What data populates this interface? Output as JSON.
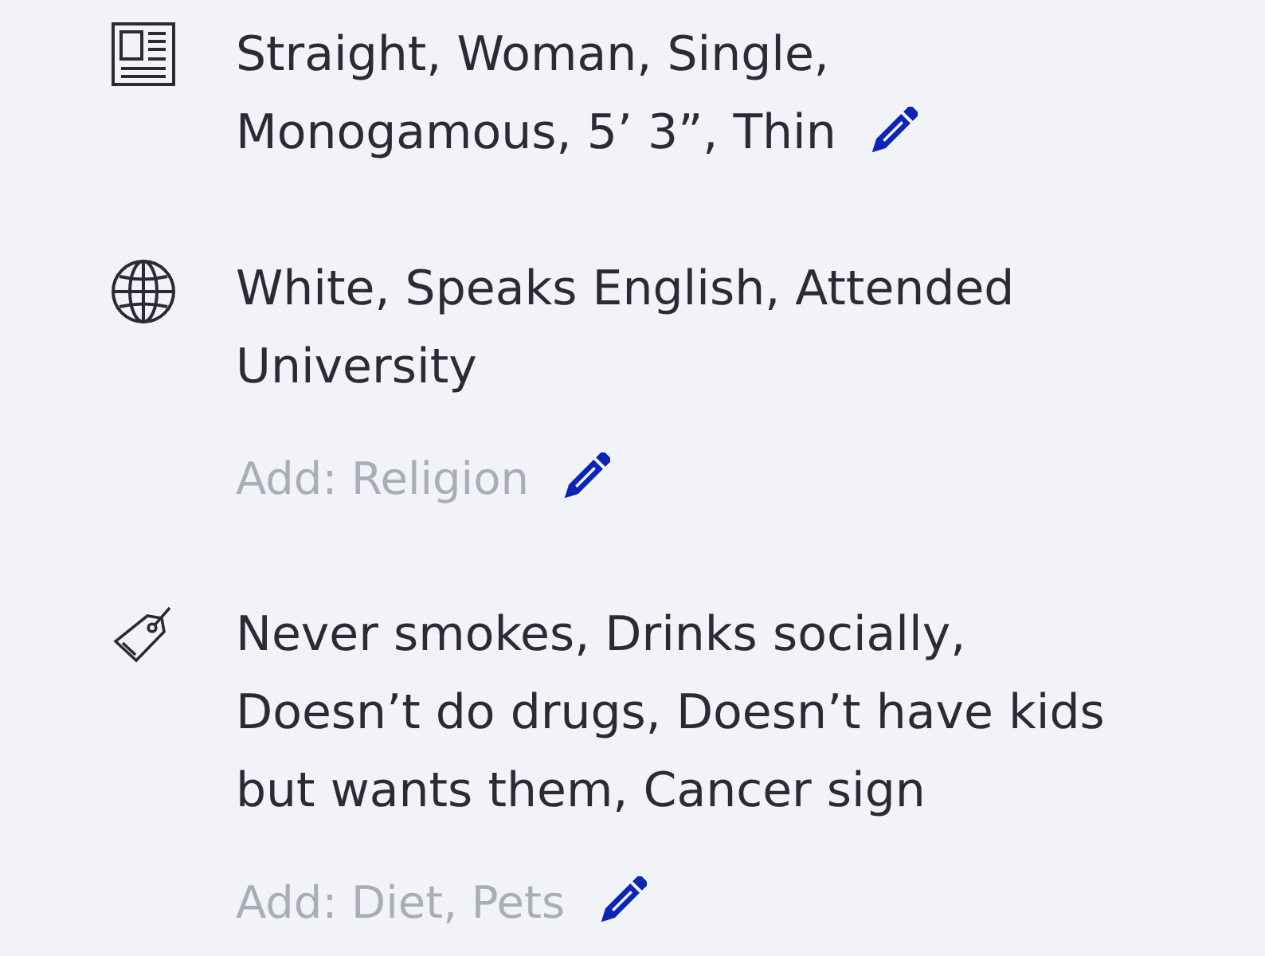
{
  "sections": [
    {
      "kind": "basics",
      "text": "Straight, Woman, Single, Monogamous, 5’ 3”, Thin"
    },
    {
      "kind": "background",
      "text": "White, Speaks English, Attended University",
      "add": "Add: Religion"
    },
    {
      "kind": "lifestyle",
      "text": "Never smokes, Drinks socially, Doesn’t do drugs, Doesn’t have kids but wants them, Cancer sign",
      "add": "Add: Diet, Pets"
    }
  ]
}
